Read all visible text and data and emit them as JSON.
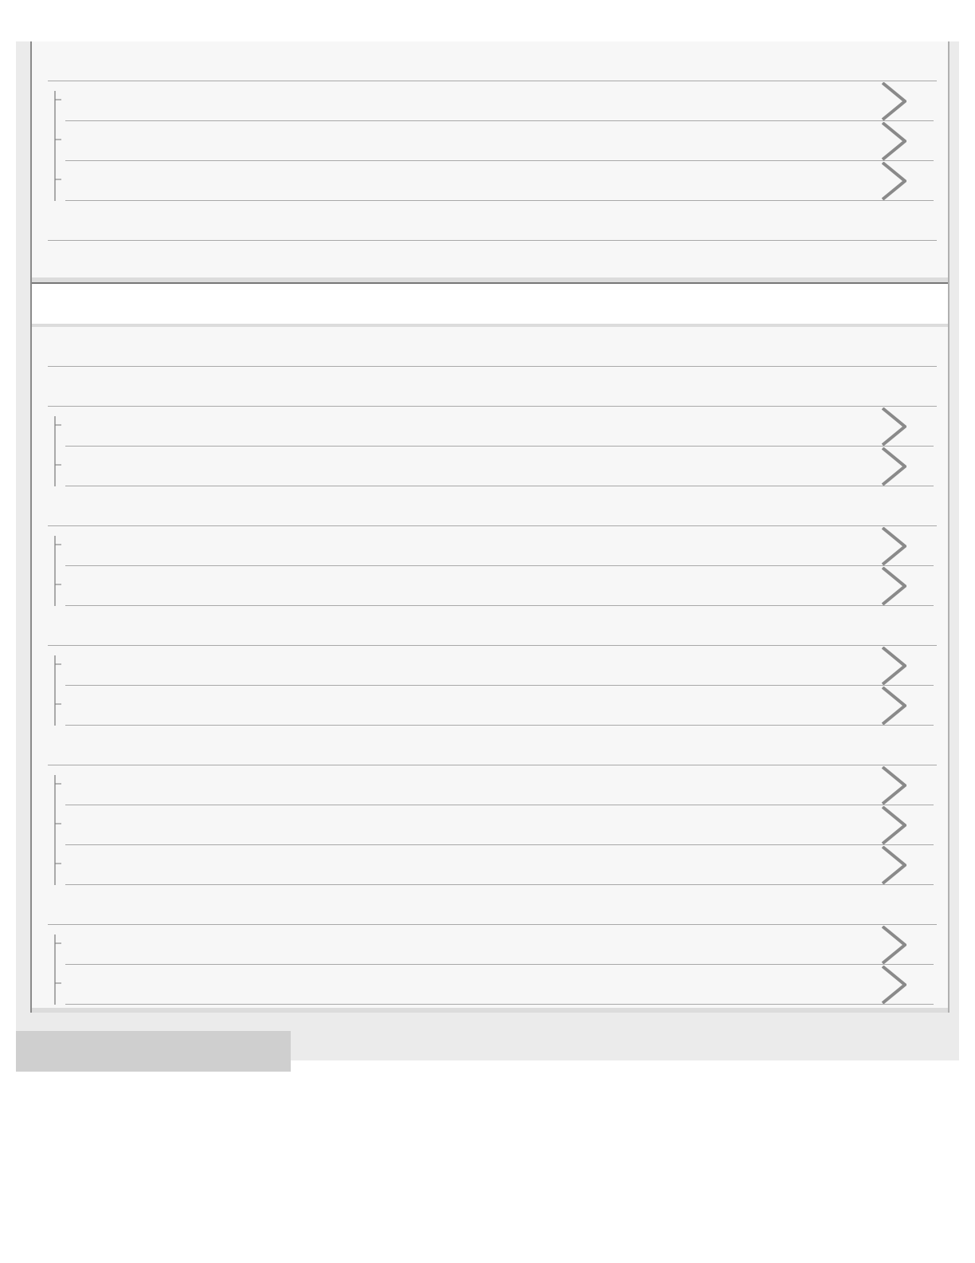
{
  "panels": [
    {
      "rows": [
        {
          "kind": "blank"
        },
        {
          "kind": "group",
          "items": [
            {
              "kind": "link"
            },
            {
              "kind": "link"
            },
            {
              "kind": "link"
            }
          ]
        },
        {
          "kind": "blank"
        }
      ]
    },
    {
      "rows": [
        {
          "kind": "blank"
        },
        {
          "kind": "blank"
        },
        {
          "kind": "group",
          "items": [
            {
              "kind": "link"
            },
            {
              "kind": "link"
            }
          ]
        },
        {
          "kind": "blank"
        },
        {
          "kind": "group",
          "items": [
            {
              "kind": "link"
            },
            {
              "kind": "link"
            }
          ]
        },
        {
          "kind": "blank"
        },
        {
          "kind": "group",
          "items": [
            {
              "kind": "link"
            },
            {
              "kind": "link"
            }
          ]
        },
        {
          "kind": "blank"
        },
        {
          "kind": "group",
          "items": [
            {
              "kind": "link"
            },
            {
              "kind": "link"
            },
            {
              "kind": "link"
            }
          ]
        },
        {
          "kind": "blank"
        },
        {
          "kind": "group",
          "items": [
            {
              "kind": "link"
            },
            {
              "kind": "link"
            }
          ]
        }
      ]
    }
  ]
}
